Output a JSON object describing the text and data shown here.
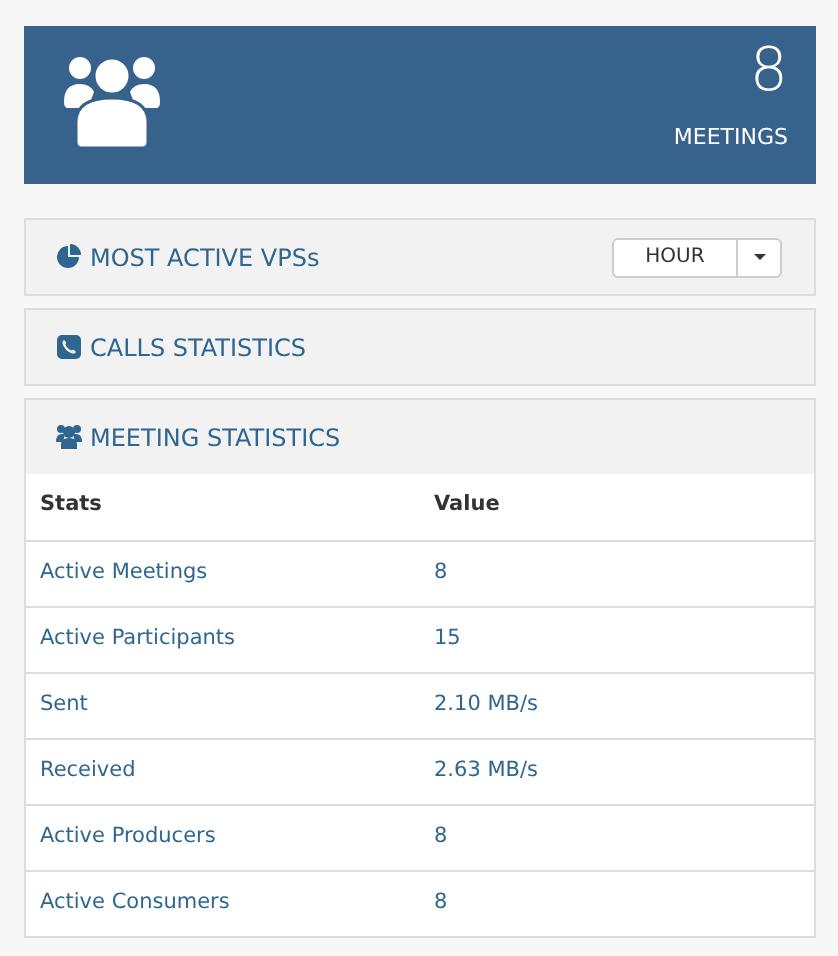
{
  "summary": {
    "count": "8",
    "label": "MEETINGS"
  },
  "panels": [
    {
      "kind": "pie",
      "title": "MOST ACTIVE VPSs",
      "dropdown": {
        "value": "HOUR"
      }
    },
    {
      "kind": "phone",
      "title": "CALLS STATISTICS"
    },
    {
      "kind": "users",
      "title": "MEETING STATISTICS",
      "table": {
        "columns": [
          "Stats",
          "Value"
        ],
        "rows": [
          [
            "Active Meetings",
            "8"
          ],
          [
            "Active Participants",
            "15"
          ],
          [
            "Sent",
            "2.10 MB/s"
          ],
          [
            "Received",
            "2.63 MB/s"
          ],
          [
            "Active Producers",
            "8"
          ],
          [
            "Active Consumers",
            "8"
          ]
        ]
      }
    }
  ]
}
